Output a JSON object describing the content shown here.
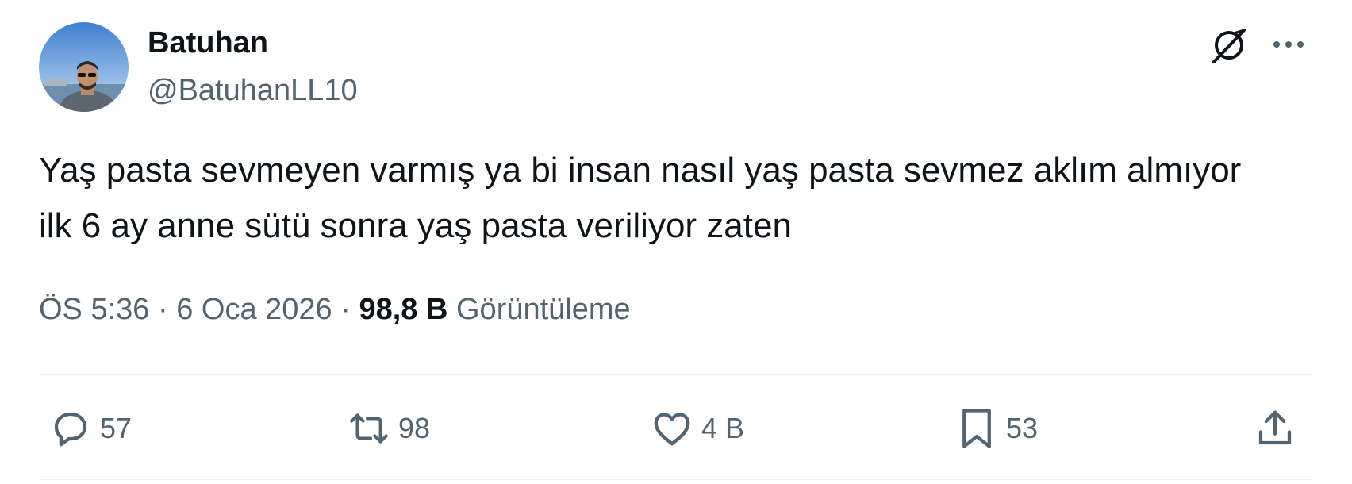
{
  "author": {
    "display_name": "Batuhan",
    "handle": "@BatuhanLL10"
  },
  "header_icons": [
    "grok-icon",
    "more-icon"
  ],
  "tweet": {
    "text": "Yaş pasta sevmeyen varmış ya bi insan nasıl yaş pasta sevmez aklım almıyor ilk 6 ay anne sütü sonra yaş pasta veriliyor zaten"
  },
  "meta": {
    "time": "ÖS 5:36",
    "separator": "·",
    "date": "6 Oca 2026",
    "views_count": "98,8 B",
    "views_label": "Görüntüleme"
  },
  "actions": {
    "replies": "57",
    "retweets": "98",
    "likes": "4 B",
    "bookmarks": "53"
  },
  "colors": {
    "text_primary": "#0f1419",
    "text_secondary": "#536471",
    "divider": "#eff3f4"
  }
}
